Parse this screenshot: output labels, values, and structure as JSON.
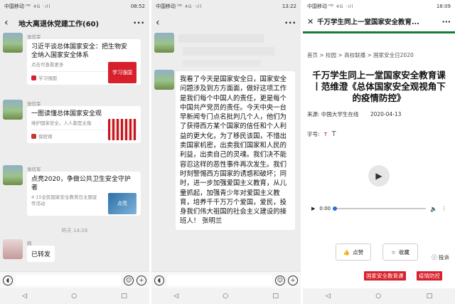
{
  "panel1": {
    "status": {
      "carrier": "中国移动 ᴴᴰ",
      "icons": "4G ·ıll",
      "time": "08:52"
    },
    "title": "地大离退休党建工作(60)",
    "messages": [
      {
        "sender": "张信军",
        "title": "习近平谈总体国家安全：把生物安全纳入国家安全体系",
        "desc": "点击可查看更多",
        "thumb_text": "学习强国",
        "source": "学习强国",
        "src_color": "#d7202b"
      },
      {
        "sender": "张信军",
        "title": "一图读懂总体国家安全观",
        "desc": "维护国家安全，人人都是主角",
        "source": "保密观",
        "src_color": "#c23a2a"
      },
      {
        "sender": "张信军",
        "title": "点亮2020，争做公共卫生安全守护者",
        "desc": "4·15全民国家安全教育日主题宣传活动",
        "thumb_text": "点亮",
        "source": "",
        "src_color": ""
      }
    ],
    "timestamp": "昨天 14:28",
    "last_sender": "韩",
    "last_bubble": "已转发"
  },
  "panel2": {
    "status": {
      "carrier": "中国移动 ᴴᴰ",
      "icons": "4G ·ıll",
      "time": "13:22"
    },
    "title": "",
    "long_message": "我看了今天是国家安全日，国家安全问题涉及到方方面面，做好这项工作是我们每个中国人的责任，更是每个中国共产党员的责任。今天中央一台早新闻专门点名批判几个人，他们为了获得西方某个国家的信任和个人利益的更大化，为了移民该国，不惜出卖国家机密，出卖我们国家和人民的利益，出卖自己的灵魂。我们决不能容忍这样的恶性事件再次发生。我们时刻警惕西方国家的诱惑和破坏；同时，进一步加强爱国主义教育，从儿童抓起，加强青少年对爱国主义教育，培养千千万万个爱国，爱民，投身我们伟大祖国的社会主义建设的接班人！ 张明兰"
  },
  "panel3": {
    "status": {
      "carrier": "中国移动 ᴴᴰ",
      "icons": "4G ·ıll",
      "time": "18:09"
    },
    "title": "千万学生同上一堂国家安全教育...",
    "breadcrumb": "首页 > 校园 > 高校联播 > 国家安全日2020",
    "headline": "千万学生同上一堂国家安全教育课丨范维澄《总体国家安全观视角下的疫情防控》",
    "source_label": "来源: 中国大学生在线",
    "date": "2020-04-13",
    "font_size_label": "字号:",
    "font_small": "T",
    "font_large": "T",
    "audio_time": "0:00",
    "audio_progress": 0,
    "like_label": "点赞",
    "fav_label": "收藏",
    "report_label": "投诉",
    "tags": [
      "国家安全教育课",
      "疫情防控"
    ]
  }
}
